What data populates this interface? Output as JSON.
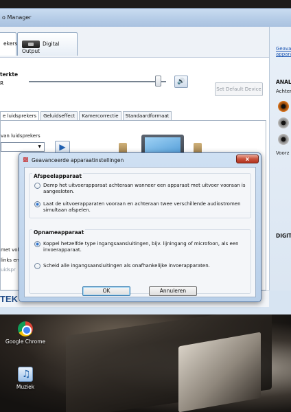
{
  "window": {
    "title": "o Manager",
    "device_tabs": [
      {
        "label": "ekers"
      },
      {
        "label": "Digital Output"
      }
    ],
    "volume": {
      "heading": "terkte",
      "channel": "R",
      "level": 0.92
    },
    "set_default_label": "Set Default Device",
    "subtabs": [
      {
        "label": "e luidsprekers"
      },
      {
        "label": "Geluidseffect"
      },
      {
        "label": "Kamercorrectie"
      },
      {
        "label": "Standaardformaat"
      }
    ],
    "config_label": "van luidsprekers",
    "left_texts": [
      "met voll",
      "links en",
      "uidspr"
    ],
    "brand": "TEK"
  },
  "right_rail": {
    "link_line1": "Geava",
    "link_line2": "appara",
    "heading1": "ANAL",
    "sub1": "Achter",
    "sub2": "Voorz",
    "heading2": "DIGIT"
  },
  "dialog": {
    "title": "Geavanceerde apparaatinstellingen",
    "close_glyph": "x",
    "playback": {
      "title": "Afspeelapparaat",
      "options": [
        {
          "label": "Demp het uitvoerapparaat achteraan wanneer een apparaat met uitvoer vooraan is aangesloten.",
          "checked": false
        },
        {
          "label": "Laat de uitvoerapparaten vooraan en achteraan twee verschillende audiostromen simultaan afspelen.",
          "checked": true
        }
      ]
    },
    "recording": {
      "title": "Opnameapparaat",
      "options": [
        {
          "label": "Koppel hetzelfde type ingangsaansluitingen, bijv. lijningang of microfoon, als een invoerapparaat.",
          "checked": true
        },
        {
          "label": "Scheid alle ingangsaansluitingen als onafhankelijke invoerapparaten.",
          "checked": false
        }
      ]
    },
    "ok_label": "OK",
    "cancel_label": "Annuleren"
  },
  "desktop": {
    "icons": [
      {
        "label": "Google Chrome",
        "icon": "chrome-icon"
      },
      {
        "label": "Muziek",
        "icon": "music-folder-icon"
      }
    ]
  }
}
